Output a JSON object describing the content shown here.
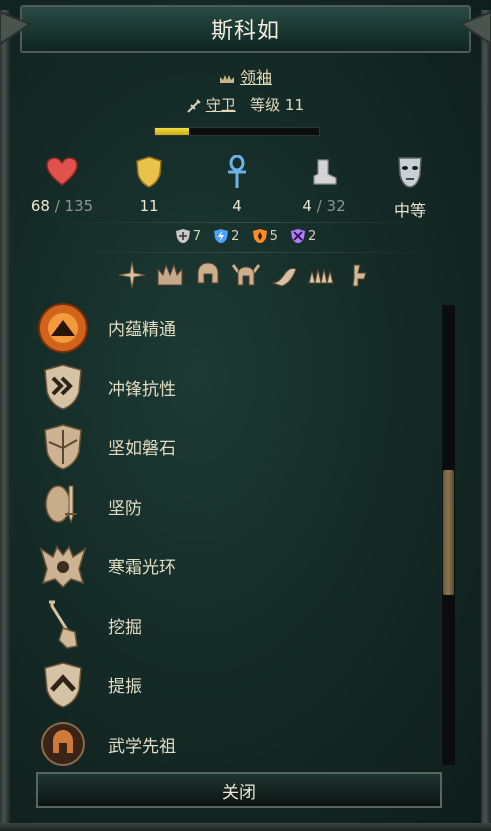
{
  "title": "斯科如",
  "leader": {
    "icon": "crown-icon",
    "label": "领袖"
  },
  "class_info": {
    "icon": "sword-icon",
    "class": "守卫",
    "level_label": "等级",
    "level": "11"
  },
  "xp_progress": 0.21,
  "stats": {
    "health": {
      "icon": "heart-icon",
      "value": "68",
      "max": "135"
    },
    "defense": {
      "icon": "shield-icon",
      "value": "11"
    },
    "ankh": {
      "icon": "ankh-icon",
      "value": "4"
    },
    "movement": {
      "icon": "boot-icon",
      "value": "4",
      "max": "32"
    },
    "difficulty": {
      "icon": "mask-icon",
      "value": "中等"
    }
  },
  "defenses": [
    {
      "icon": "physical-defense-icon",
      "value": "7",
      "color": "#c8c8c8"
    },
    {
      "icon": "lightning-defense-icon",
      "value": "2",
      "color": "#4aa3ff"
    },
    {
      "icon": "fire-defense-icon",
      "value": "5",
      "color": "#ff8a2a"
    },
    {
      "icon": "magic-defense-icon",
      "value": "2",
      "color": "#b07cff"
    }
  ],
  "immunities": [
    "star-burst-icon",
    "crown-spikes-icon",
    "helmet-icon",
    "horned-helmet-icon",
    "foot-icon",
    "spikes-icon",
    "broken-arrow-icon"
  ],
  "abilities": [
    {
      "icon": "inner-mastery-icon",
      "label": "内蕴精通"
    },
    {
      "icon": "charge-resist-icon",
      "label": "冲锋抗性"
    },
    {
      "icon": "rock-solid-icon",
      "label": "坚如磐石"
    },
    {
      "icon": "shield-sword-icon",
      "label": "坚防"
    },
    {
      "icon": "frost-aura-icon",
      "label": "寒霜光环"
    },
    {
      "icon": "shovel-icon",
      "label": "挖掘"
    },
    {
      "icon": "rally-icon",
      "label": "提振"
    },
    {
      "icon": "martial-ancestor-icon",
      "label": "武学先祖"
    }
  ],
  "close_label": "关闭",
  "colors": {
    "accent_gold": "#d9c07a",
    "xp_fill": "#f3e040",
    "panel_bg": "#152b27"
  }
}
